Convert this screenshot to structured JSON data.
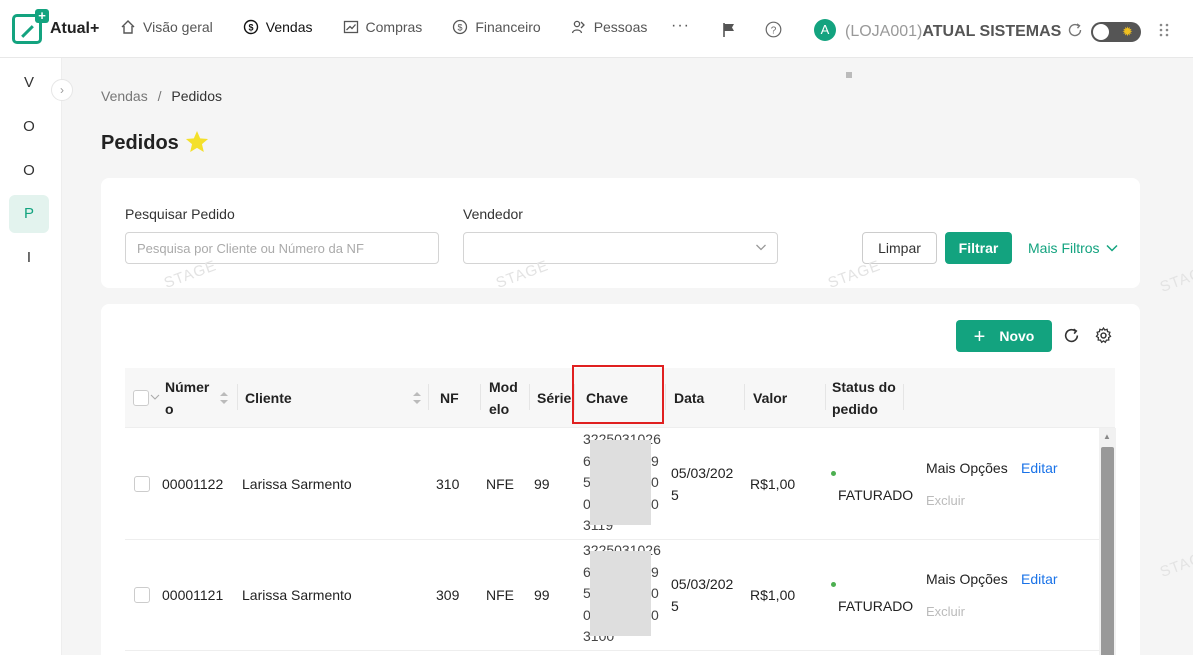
{
  "app": {
    "logo_text": "Atual+"
  },
  "nav": {
    "items": [
      {
        "label": "Visão geral",
        "icon": "home-icon"
      },
      {
        "label": "Vendas",
        "icon": "dollar-icon"
      },
      {
        "label": "Compras",
        "icon": "chart-icon"
      },
      {
        "label": "Financeiro",
        "icon": "dollar-icon"
      },
      {
        "label": "Pessoas",
        "icon": "people-icon"
      }
    ],
    "more": "···"
  },
  "user": {
    "avatar_letter": "A",
    "store_prefix": "(LOJA001)",
    "store_name": "ATUAL SISTEMAS"
  },
  "sidebar": {
    "items": [
      "V",
      "O",
      "O",
      "P",
      "I"
    ],
    "collapse_label": "›"
  },
  "breadcrumb": {
    "parent": "Vendas",
    "separator": "/",
    "current": "Pedidos"
  },
  "page": {
    "title": "Pedidos"
  },
  "filters": {
    "search_label": "Pesquisar Pedido",
    "search_placeholder": "Pesquisa por Cliente ou Número da NF",
    "seller_label": "Vendedor",
    "seller_value": "",
    "clear_label": "Limpar",
    "filter_label": "Filtrar",
    "more_filters_label": "Mais Filtros"
  },
  "toolbar": {
    "new_label": "Novo"
  },
  "table": {
    "headers": {
      "numero_l1": "Númer",
      "numero_l2": "o",
      "cliente": "Cliente",
      "nf": "NF",
      "modelo_l1": "Mod",
      "modelo_l2": "elo",
      "serie": "Série",
      "chave": "Chave",
      "data": "Data",
      "valor": "Valor",
      "status_l1": "Status do",
      "status_l2": "pedido"
    },
    "rows": [
      {
        "numero": "00001122",
        "cliente": "Larissa Sarmento",
        "nf": "310",
        "modelo": "NFE",
        "serie": "99",
        "chave_l1": "3225031026",
        "chave_l2": "6",
        "chave_l2r": "9",
        "chave_l3": "5",
        "chave_l3r": "0",
        "chave_l4": "0",
        "chave_l4r": "0",
        "chave_l5": "3119",
        "data_l1": "05/03/202",
        "data_l2": "5",
        "valor": "R$1,00",
        "status": "FATURADO",
        "more_options": "Mais Opções",
        "edit": "Editar",
        "delete": "Excluir"
      },
      {
        "numero": "00001121",
        "cliente": "Larissa Sarmento",
        "nf": "309",
        "modelo": "NFE",
        "serie": "99",
        "chave_l1": "3225031026",
        "chave_l2": "6",
        "chave_l2r": "9",
        "chave_l3": "5",
        "chave_l3r": "0",
        "chave_l4": "0",
        "chave_l4r": "0",
        "chave_l5": "3100",
        "data_l1": "05/03/202",
        "data_l2": "5",
        "valor": "R$1,00",
        "status": "FATURADO",
        "more_options": "Mais Opções",
        "edit": "Editar",
        "delete": "Excluir"
      }
    ]
  },
  "watermark": "STAGE",
  "colors": {
    "accent": "#13a37f",
    "link": "#1a73e8",
    "highlight": "#e02020"
  }
}
